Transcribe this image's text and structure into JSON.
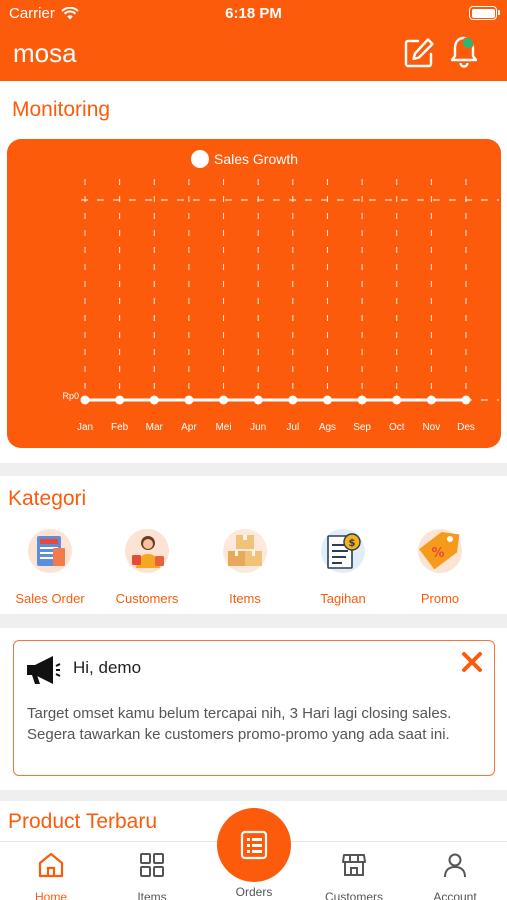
{
  "status_bar": {
    "carrier": "Carrier",
    "time": "6:18 PM"
  },
  "header": {
    "title": "mosa"
  },
  "monitoring": {
    "title": "Monitoring"
  },
  "chart_data": {
    "type": "line",
    "title": "",
    "legend": [
      "Sales Growth"
    ],
    "legend_placement": "top-center",
    "categories": [
      "Jan",
      "Feb",
      "Mar",
      "Apr",
      "Mei",
      "Jun",
      "Jul",
      "Ags",
      "Sep",
      "Oct",
      "Nov",
      "Des"
    ],
    "series": [
      {
        "name": "Sales Growth",
        "values": [
          0,
          0,
          0,
          0,
          0,
          0,
          0,
          0,
          0,
          0,
          0,
          0
        ]
      }
    ],
    "y_tick_labels": [
      "Rp0"
    ],
    "grid": true,
    "colors": {
      "background": "#fb5b0b",
      "line": "#ffffff",
      "grid": "#ffffff"
    }
  },
  "kategori": {
    "title": "Kategori",
    "items": [
      {
        "label": "Sales Order",
        "icon": "sales-order-icon"
      },
      {
        "label": "Customers",
        "icon": "customers-icon"
      },
      {
        "label": "Items",
        "icon": "items-boxes-icon"
      },
      {
        "label": "Tagihan",
        "icon": "invoice-icon"
      },
      {
        "label": "Promo",
        "icon": "promo-tag-icon"
      }
    ]
  },
  "notice": {
    "greeting": "Hi, demo",
    "message": "Target omset kamu belum tercapai nih, 3 Hari lagi closing sales. Segera tawarkan ke customers promo-promo yang ada saat ini."
  },
  "product": {
    "title": "Product Terbaru"
  },
  "bottom_nav": {
    "items": [
      {
        "label": "Home",
        "icon": "home-icon",
        "active": true
      },
      {
        "label": "Items",
        "icon": "grid-icon",
        "active": false
      },
      {
        "label": "Orders",
        "icon": "orders-icon",
        "active": false
      },
      {
        "label": "Customers",
        "icon": "store-icon",
        "active": false
      },
      {
        "label": "Account",
        "icon": "user-icon",
        "active": false
      }
    ]
  },
  "colors": {
    "accent": "#fb5b0b",
    "notification_dot": "#2bb673",
    "close": "#fb5b0b"
  }
}
